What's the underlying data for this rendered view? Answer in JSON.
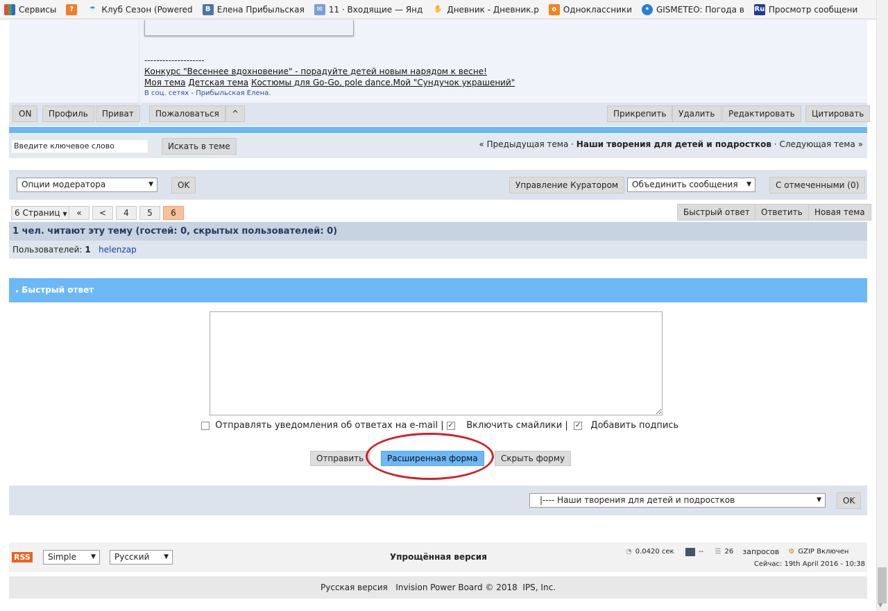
{
  "bookmarks": [
    "Сервисы",
    "Клуб Сезон (Powered",
    "Елена Прибыльская",
    "11 · Входящие — Янд",
    "Дневник - Дневник.р",
    "Одноклассники",
    "GISMETEO: Погода в",
    "Просмотр сообщени"
  ],
  "post": {
    "separator": "--------------------",
    "sig_line1": "Конкурс \"Весеннее вдохновение\" - порадуйте детей новым нарядом к весне!",
    "sig_links": [
      "Моя тема",
      "Детская тема",
      "Костюмы для Go-Go, pole dance.Мой \"Сундучок украшений\""
    ],
    "social": "В соц. сетях - Прибыльская Елена."
  },
  "post_buttons": {
    "on": "ON",
    "profile": "Профиль",
    "private": "Приват",
    "report": "Пожаловаться",
    "up": "^",
    "pin": "Прикрепить",
    "delete": "Удалить",
    "edit": "Редактировать",
    "quote": "Цитировать"
  },
  "search": {
    "placeholder": "Введите ключевое слово",
    "button": "Искать в теме",
    "prev": "« Предыдущая тема",
    "current": "Наши творения для детей и подростков",
    "next": "Следующая тема »",
    "dot": "·"
  },
  "moderation": {
    "options": "Опции модератора",
    "ok": "OK",
    "curator": "Управление Куратором",
    "merge": "Объединить сообщения",
    "selected": "С отмеченными (0)"
  },
  "pagination": {
    "pages": "6 Страниц",
    "first": "«",
    "prev": "<",
    "items": [
      "4",
      "5",
      "6"
    ],
    "fast_reply": "Быстрый ответ",
    "reply": "Ответить",
    "new_topic": "Новая тема"
  },
  "readers": {
    "header": "1 чел. читают эту тему (гостей: 0, скрытых пользователей: 0)",
    "users_label": "Пользователей:",
    "count": "1",
    "user": "helenzap"
  },
  "quick_reply": {
    "title": "Быстрый ответ",
    "notify": "Отправлять уведомления об ответах на e-mail",
    "smilies": "Включить смайлики",
    "signature": "Добавить подпись",
    "sep": "|",
    "send": "Отправить",
    "advanced": "Расширенная форма",
    "hide": "Скрыть форму"
  },
  "forum_jump": {
    "selected": "|---- Наши творения для детей и подростков",
    "ok": "OK"
  },
  "footer": {
    "rss": "RSS",
    "skin": "Simple",
    "lang": "Русский",
    "lite": "Упрощённая версия",
    "time": "0.0420 сек",
    "load": "--",
    "queries_count": "26",
    "queries": "запросов",
    "gzip": "GZIP Включен",
    "now": "Сейчас: 19th April 2016 - 10:38",
    "copyright": "Русская версия   Invision Power Board © 2018  IPS, Inc."
  },
  "colors": {
    "accent": "#6cb8f7",
    "bar": "#dde3ec",
    "highlight": "#f9c09a"
  }
}
